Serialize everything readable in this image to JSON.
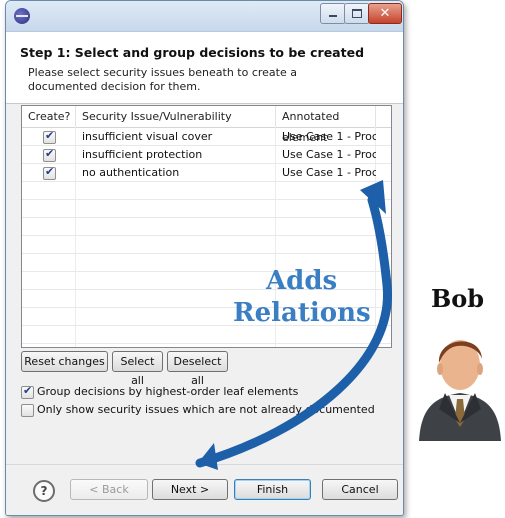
{
  "window": {
    "icon": "eclipse-icon"
  },
  "header": {
    "title": "Step 1: Select and group decisions to be created",
    "description": "Please select security issues beneath to create a documented decision for them."
  },
  "table": {
    "columns": [
      "Create?",
      "Security Issue/Vulnerability",
      "Annotated element"
    ],
    "rows": [
      {
        "create": true,
        "issue": "insufficient visual cover",
        "element": "Use Case 1 - Proc..."
      },
      {
        "create": true,
        "issue": "insufficient protection",
        "element": "Use Case 1 - Proc..."
      },
      {
        "create": true,
        "issue": "no authentication",
        "element": "Use Case 1 - Proc..."
      }
    ]
  },
  "buttons": {
    "reset": "Reset changes",
    "select_all": "Select all",
    "deselect_all": "Deselect all"
  },
  "options": {
    "group": {
      "label": "Group decisions by highest-order leaf elements",
      "checked": true
    },
    "only_undocumented": {
      "label": "Only show security issues which are not already documented",
      "checked": false
    }
  },
  "footer": {
    "help_icon": "?",
    "back": "< Back",
    "next": "Next >",
    "finish": "Finish",
    "cancel": "Cancel"
  },
  "annotation": {
    "line1": "Adds",
    "line2": "Relations",
    "color": "#3a7fc4"
  },
  "person": {
    "name": "Bob",
    "icon": "businessman-avatar-icon"
  }
}
